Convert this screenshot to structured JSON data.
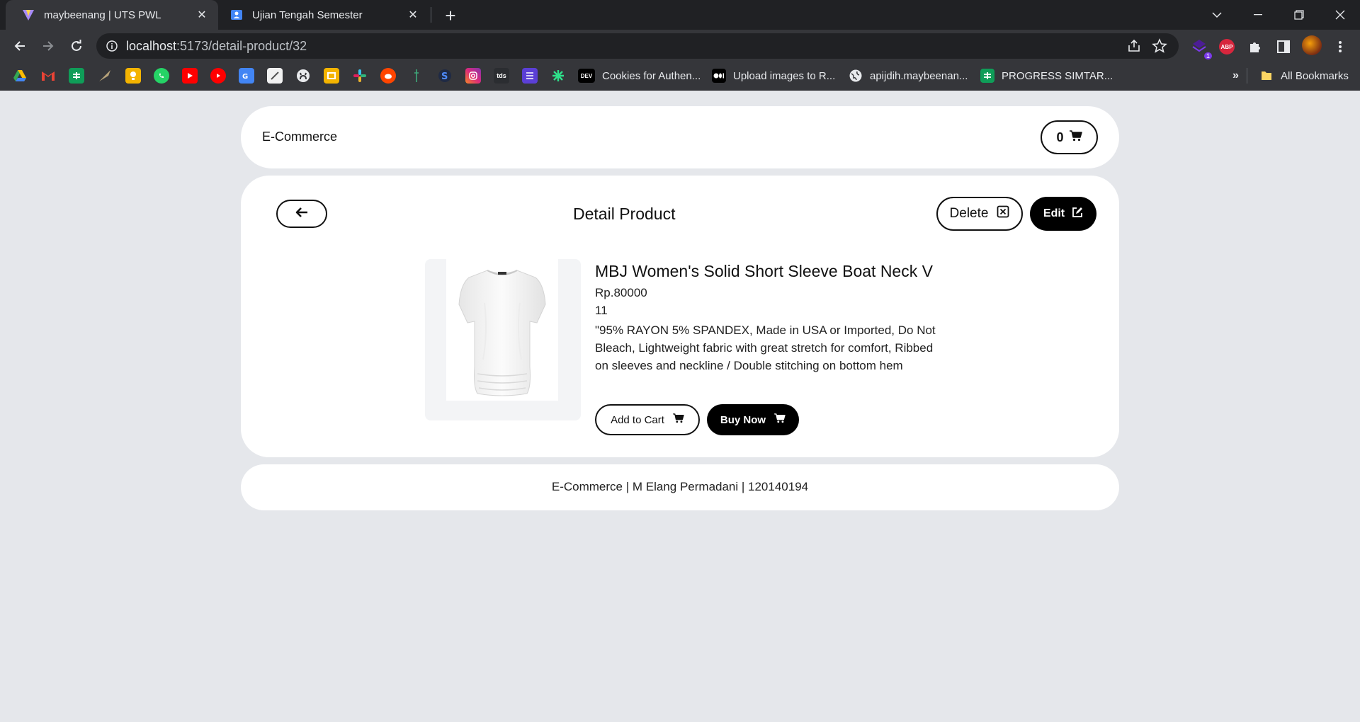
{
  "browser": {
    "tabs": [
      {
        "title": "maybeenang | UTS PWL",
        "active": true,
        "icon": "vite-icon"
      },
      {
        "title": "Ujian Tengah Semester",
        "active": false,
        "icon": "classroom-icon"
      }
    ],
    "url": {
      "host": "localhost",
      "path": ":5173/detail-product/32"
    },
    "bookmarks": [
      {
        "label": "Cookies for Authen...",
        "icon": "dev-icon"
      },
      {
        "label": "Upload images to R...",
        "icon": "medium-icon"
      },
      {
        "label": "apijdih.maybeenan...",
        "icon": "globe-icon"
      },
      {
        "label": "PROGRESS SIMTAR...",
        "icon": "sheets-icon"
      }
    ],
    "bookmarks_overflow": "»",
    "all_bookmarks": "All Bookmarks",
    "extension_badge": "1",
    "abp_label": "ABP",
    "tds_label": "tds",
    "dev_label": "DEV"
  },
  "navbar": {
    "brand": "E-Commerce",
    "cart_count": "0"
  },
  "detail": {
    "title": "Detail Product",
    "delete_label": "Delete",
    "edit_label": "Edit",
    "product": {
      "name": "MBJ Women's Solid Short Sleeve Boat Neck V",
      "price": "Rp.80000",
      "stock": "11",
      "description": "\"95% RAYON 5% SPANDEX, Made in USA or Imported, Do Not Bleach, Lightweight fabric with great stretch for comfort, Ribbed on sleeves and neckline / Double stitching on bottom hem"
    },
    "add_to_cart_label": "Add to Cart",
    "buy_now_label": "Buy Now"
  },
  "footer": {
    "text": "E-Commerce | M Elang Permadani | 120140194"
  }
}
